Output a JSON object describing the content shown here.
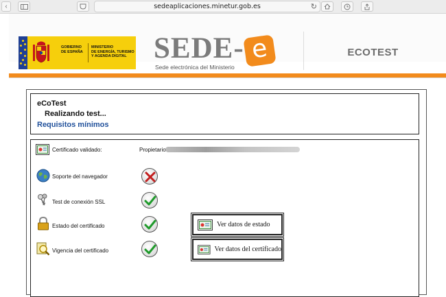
{
  "browser": {
    "url": "sedeaplicaciones.minetur.gob.es"
  },
  "header": {
    "gov_line1": "GOBIERNO",
    "gov_line2": "DE ESPAÑA",
    "ministry_line1": "MINISTERIO",
    "ministry_line2": "DE ENERGÍA, TURISMO",
    "ministry_line3": "Y AGENDA DIGITAL",
    "sede_title": "SEDE-",
    "sede_e": "e",
    "sede_subtitle": "Sede electrónica del Ministerio",
    "app_name": "ECOTEST"
  },
  "colors": {
    "accent_orange": "#f28b1c",
    "link_blue": "#1f4f9a",
    "gov_yellow": "#f6cf0c",
    "eu_blue": "#1f3f94"
  },
  "title_box": {
    "app": "eCoTest",
    "status": "Realizando test...",
    "requirements_link": "Requisitos mínimos"
  },
  "tests": {
    "certificate": {
      "label": "Certificado validado:",
      "owner_label": "Propietario:",
      "icon": "certificate-icon"
    },
    "rows": [
      {
        "label": "Soporte del navegador",
        "icon": "globe-icon",
        "status": "fail"
      },
      {
        "label": "Test de conexión SSL",
        "icon": "keys-icon",
        "status": "ok"
      },
      {
        "label": "Estado del certificado",
        "icon": "padlock-icon",
        "status": "ok",
        "button": "Ver datos de estado"
      },
      {
        "label": "Vigencia del certificado",
        "icon": "magnifier-certificate-icon",
        "status": "ok",
        "button": "Ver datos del certificado"
      }
    ]
  }
}
